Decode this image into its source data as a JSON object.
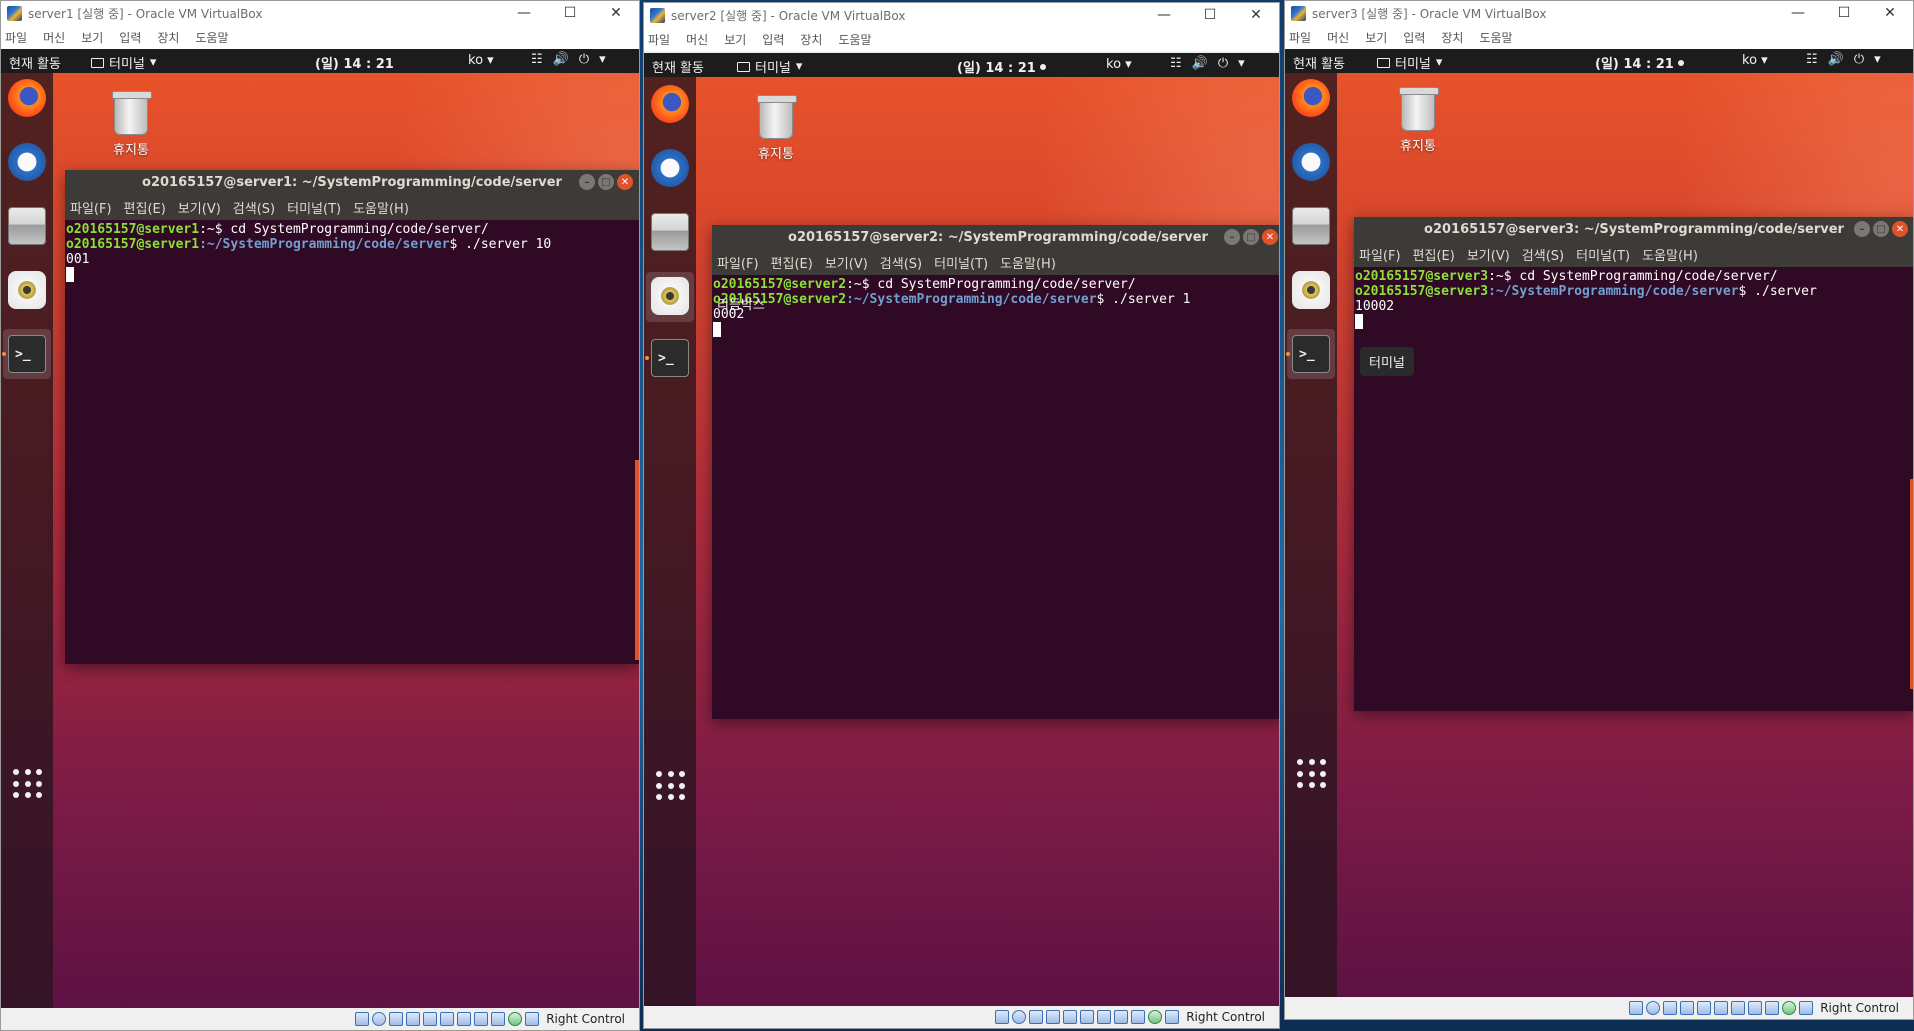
{
  "windows": [
    {
      "title": "server1 [실행 중] - Oracle VM VirtualBox",
      "vb_menu": [
        "파일",
        "머신",
        "보기",
        "입력",
        "장치",
        "도움말"
      ],
      "topbar": {
        "activities": "현재 활동",
        "app": "터미널",
        "clock": "(일) 14 : 21",
        "lang": "ko"
      },
      "trash_label": "휴지통",
      "terminal": {
        "title": "o20165157@server1: ~/SystemProgramming/code/server",
        "menu": [
          "파일(F)",
          "편집(E)",
          "보기(V)",
          "검색(S)",
          "터미널(T)",
          "도움말(H)"
        ],
        "line1_user": "o20165157@server1",
        "line1_rest": ":~$ cd SystemProgramming/code/server/",
        "line2_user": "o20165157@server1",
        "line2_path": ":~/SystemProgramming/code/server",
        "line2_cmd": "$ ./server 10",
        "line3": "001"
      },
      "status_label": "Right Control"
    },
    {
      "title": "server2 [실행 중] - Oracle VM VirtualBox",
      "vb_menu": [
        "파일",
        "머신",
        "보기",
        "입력",
        "장치",
        "도움말"
      ],
      "topbar": {
        "activities": "현재 활동",
        "app": "터미널",
        "clock": "(일) 14 : 21",
        "lang": "ko"
      },
      "trash_label": "휴지통",
      "terminal": {
        "title": "o20165157@server2: ~/SystemProgramming/code/server",
        "menu": [
          "파일(F)",
          "편집(E)",
          "보기(V)",
          "검색(S)",
          "터미널(T)",
          "도움말(H)"
        ],
        "line1_user": "o20165157@server2",
        "line1_rest": ":~$ cd SystemProgramming/code/server/",
        "line2_user": "o20165157@server2",
        "line2_path": ":~/SystemProgramming/code/server",
        "line2_cmd": "$ ./server 1",
        "line3": "0002"
      },
      "tooltip": "리듬박스",
      "status_label": "Right Control"
    },
    {
      "title": "server3 [실행 중] - Oracle VM VirtualBox",
      "vb_menu": [
        "파일",
        "머신",
        "보기",
        "입력",
        "장치",
        "도움말"
      ],
      "topbar": {
        "activities": "현재 활동",
        "app": "터미널",
        "clock": "(일) 14 : 21",
        "lang": "ko"
      },
      "trash_label": "휴지통",
      "terminal": {
        "title": "o20165157@server3: ~/SystemProgramming/code/server",
        "menu": [
          "파일(F)",
          "편집(E)",
          "보기(V)",
          "검색(S)",
          "터미널(T)",
          "도움말(H)"
        ],
        "line1_user": "o20165157@server3",
        "line1_rest": ":~$ cd SystemProgramming/code/server/",
        "line2_user": "o20165157@server3",
        "line2_path": ":~/SystemProgramming/code/server",
        "line2_cmd": "$ ./server",
        "line3": "10002"
      },
      "tooltip": "터미널",
      "status_label": "Right Control"
    }
  ],
  "icons": {
    "minimize": "minimize-icon",
    "maximize": "maximize-icon",
    "close": "close-icon",
    "dropdown": "chevron-down-icon",
    "network": "network-icon",
    "volume": "volume-icon",
    "power": "power-icon"
  }
}
